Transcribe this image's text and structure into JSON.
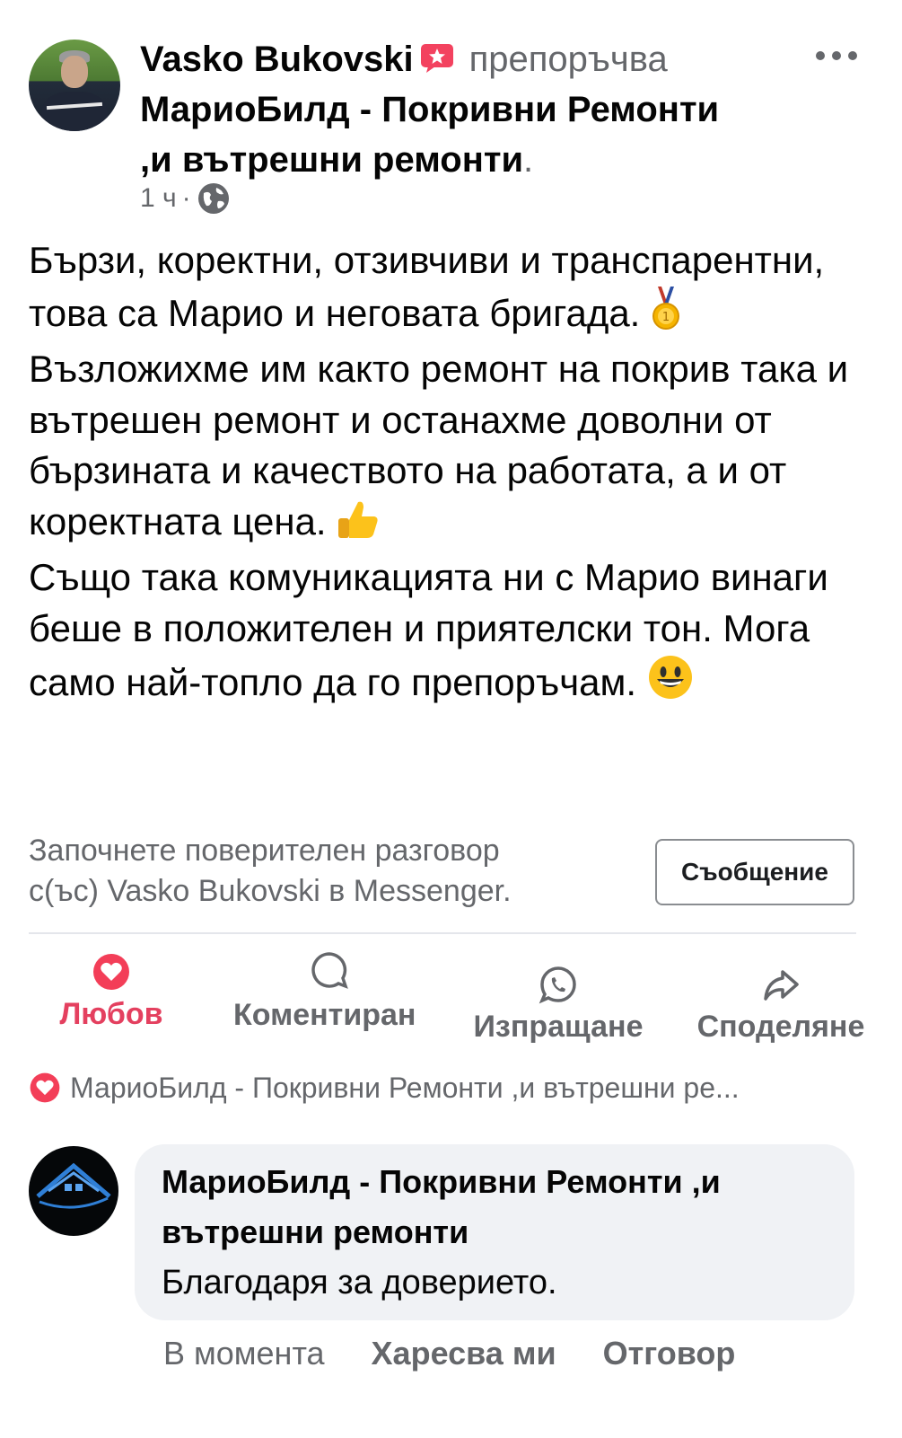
{
  "post": {
    "author": "Vasko Bukovski",
    "recommends_verb": "препоръчва",
    "page_name": "МариоБилд - Покривни Ремонти ,и вътрешни ремонти",
    "page_name_suffix": ".",
    "time": "1 ч",
    "separator": "·",
    "privacy_icon": "globe-icon",
    "more_icon": "more-dots-icon",
    "text_paragraphs": [
      "Бързи, коректни, отзивчиви и транспарентни, това са Марио и неговата бригада.",
      "Възложихме им както ремонт на покрив така и вътрешен ремонт и останахме доволни от бързината и качеството на работата, а и от коректната цена.",
      "Също така комуникацията ни с Марио винаги беше в положителен и приятелски тон. Мога само най-топло да го препоръчам."
    ],
    "emojis": [
      "medal-icon",
      "thumbs-up-icon",
      "smile-icon"
    ]
  },
  "messenger": {
    "prompt_line1": "Започнете поверителен разговор",
    "prompt_line2": "с(ъс) Vasko Bukovski в Messenger.",
    "button_label": "Съобщение"
  },
  "actions": {
    "love": "Любов",
    "comment": "Коментиране",
    "send": "Изпращане",
    "share": "Споделяне"
  },
  "reaction_summary": "МариоБилд - Покривни Ремонти ,и вътрешни ре...",
  "comment": {
    "author": "МариоБилд - Покривни Ремонти ,и вътрешни ремонти",
    "text": "Благодаря за доверието.",
    "time": "В момента",
    "like_label": "Харесва ми",
    "reply_label": "Отговор"
  },
  "colors": {
    "love": "#e4405f",
    "secondary_text": "#65676b",
    "bubble": "#f0f2f5"
  }
}
